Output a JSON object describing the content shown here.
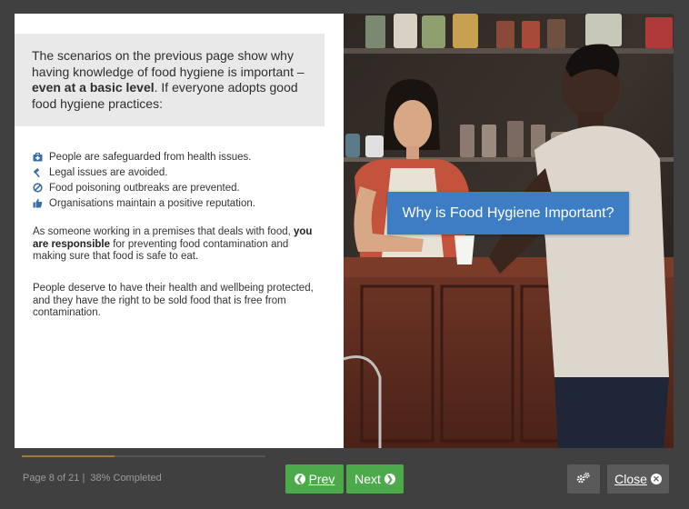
{
  "content": {
    "intro_pre": "The scenarios on the previous page show why having knowledge of food hygiene is important – ",
    "intro_bold": "even at a basic level",
    "intro_post": ". If everyone adopts good food hygiene practices:",
    "bullets": [
      {
        "text": "People are safeguarded from health issues.",
        "icon": "first-aid-kit-icon"
      },
      {
        "text": "Legal issues are avoided.",
        "icon": "gavel-icon"
      },
      {
        "text": "Food poisoning outbreaks are prevented.",
        "icon": "ban-icon"
      },
      {
        "text": "Organisations maintain a positive reputation.",
        "icon": "thumbs-up-icon"
      }
    ],
    "para1_pre": "As someone working in a premises that deals with food, ",
    "para1_bold": "you are responsible",
    "para1_post": " for preventing food contamination and making sure that food is safe to eat.",
    "para2": "People deserve to have their health and wellbeing protected, and they have the right to be sold food that is free from contamination.",
    "banner": "Why is Food Hygiene Important?"
  },
  "footer": {
    "page_label": "Page 8 of 21",
    "completed_label": "38% Completed",
    "progress": 0.38,
    "prev_label": "Prev",
    "next_label": "Next",
    "close_label": "Close"
  },
  "colors": {
    "background": "#404040",
    "accent_green": "#4caa4a",
    "banner_blue": "#3d7dc4",
    "progress_fill": "#a07840"
  }
}
